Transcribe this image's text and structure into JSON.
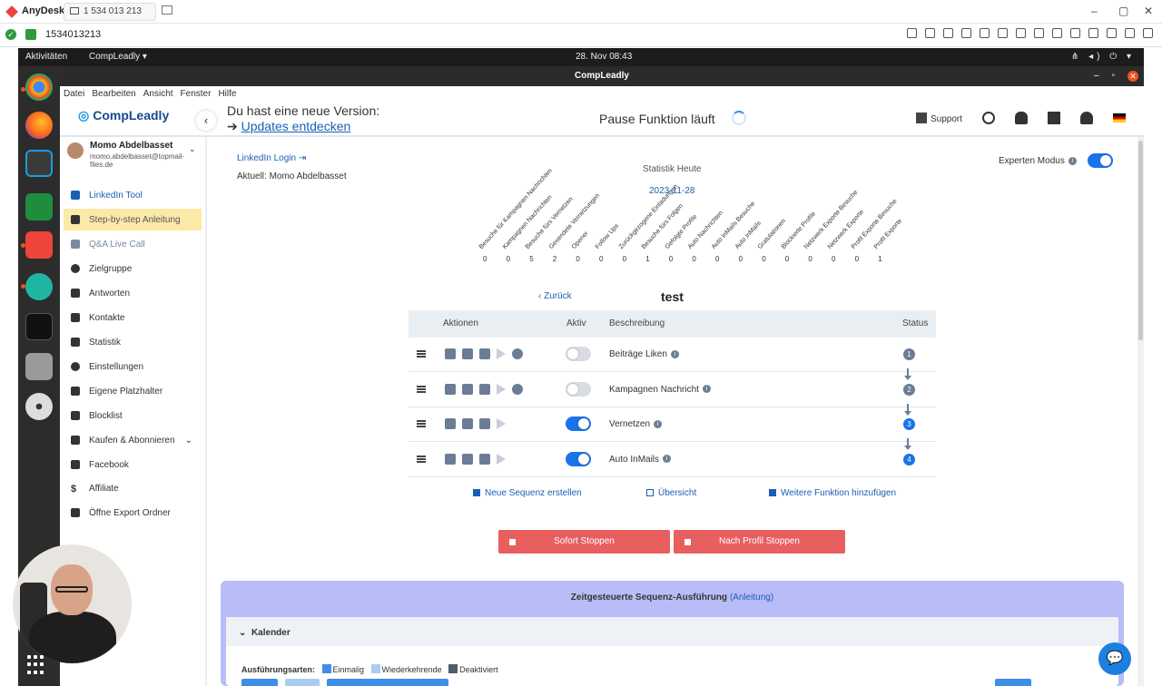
{
  "anydesk": {
    "app_name": "AnyDesk",
    "tab_label": "1 534 013 213",
    "address": "1534013213"
  },
  "system_bar": {
    "activities": "Aktivitäten",
    "app_menu": "CompLeadly ▾",
    "datetime": "28. Nov  08:43"
  },
  "window": {
    "title": "CompLeadly",
    "min": "–",
    "max": "▫",
    "close": "✕"
  },
  "menubar": [
    "Datei",
    "Bearbeiten",
    "Ansicht",
    "Fenster",
    "Hilfe"
  ],
  "header": {
    "logo": "CompLeadly",
    "update_line1": "Du hast eine neue Version:",
    "update_arrow": "➔",
    "update_link": "Updates entdecken",
    "pause_text": "Pause Funktion läuft",
    "support": "Support",
    "collapse": "‹"
  },
  "profile": {
    "name": "Momo Abdelbasset",
    "email": "momo.abdelbasset@topmail-files.de",
    "chevron": "⌄"
  },
  "sidebar": {
    "items": [
      {
        "label": "LinkedIn Tool"
      },
      {
        "label": "Step-by-step Anleitung"
      },
      {
        "label": "Q&A Live Call"
      },
      {
        "label": "Zielgruppe"
      },
      {
        "label": "Antworten"
      },
      {
        "label": "Kontakte"
      },
      {
        "label": "Statistik"
      },
      {
        "label": "Einstellungen"
      },
      {
        "label": "Eigene Platzhalter"
      },
      {
        "label": "Blocklist"
      },
      {
        "label": "Kaufen & Abonnieren"
      },
      {
        "label": "Facebook"
      },
      {
        "label": "Affiliate"
      },
      {
        "label": "Öffne Export Ordner"
      }
    ]
  },
  "main": {
    "linkedin_login": "LinkedIn Login",
    "aktuell": "Aktuell: Momo Abdelbasset",
    "stat_title": "Statistik Heute",
    "stat_date": "2023-11-28",
    "expert_mode": "Experten Modus",
    "expert_mode_on": true,
    "back": "‹ Zurück",
    "sequence_name": "test",
    "table_headers": {
      "aktionen": "Aktionen",
      "aktiv": "Aktiv",
      "beschreibung": "Beschreibung",
      "status": "Status"
    },
    "rows": [
      {
        "desc": "Beiträge Liken",
        "active": false,
        "status": "1"
      },
      {
        "desc": "Kampagnen Nachricht",
        "active": false,
        "status": "2"
      },
      {
        "desc": "Vernetzen",
        "active": true,
        "status": "3"
      },
      {
        "desc": "Auto InMails",
        "active": true,
        "status": "4"
      }
    ],
    "links": {
      "new_seq": "Neue Sequenz erstellen",
      "overview": "Übersicht",
      "add_fn": "Weitere Funktion hinzufügen"
    },
    "buttons": {
      "stop_now": "Sofort Stoppen",
      "stop_after": "Nach Profil Stoppen"
    },
    "scheduled_title": "Zeitgesteuerte Sequenz-Ausführung",
    "scheduled_link": "(Anleitung)",
    "calendar": "Kalender",
    "arten_label": "Ausführungsarten:",
    "arten": [
      "Einmalig",
      "Wiederkehrende",
      "Deaktiviert"
    ]
  },
  "chart_data": {
    "type": "bar",
    "title": "Statistik Heute",
    "categories": [
      "Besuche für Kampagnen Nachrichten",
      "Kampagnen Nachrichten",
      "Besuche fürs Vernetzen",
      "Gesendete Vernetzungen",
      "Opener",
      "Follow Ups",
      "Zurückgezogene Einladungen",
      "Besuche fürs Folgen",
      "Gefolgte Profile",
      "Auto Nachrichten",
      "Auto InMails Besuche",
      "Auto InMails",
      "Gratulationen",
      "Blockierte Profile",
      "Netzwerk Exporte Besuche",
      "Netzwerk Exporte",
      "Profil Exporte Besuche",
      "Profil Exporte"
    ],
    "values": [
      0,
      0,
      5,
      2,
      0,
      0,
      0,
      1,
      0,
      0,
      0,
      0,
      0,
      0,
      0,
      0,
      0,
      1
    ]
  },
  "colors": {
    "accent": "#1a73e8",
    "brand": "#184a8a",
    "stop": "#e85f5f",
    "highlight": "#fbe9a8",
    "panel": "#b8bdf7"
  }
}
